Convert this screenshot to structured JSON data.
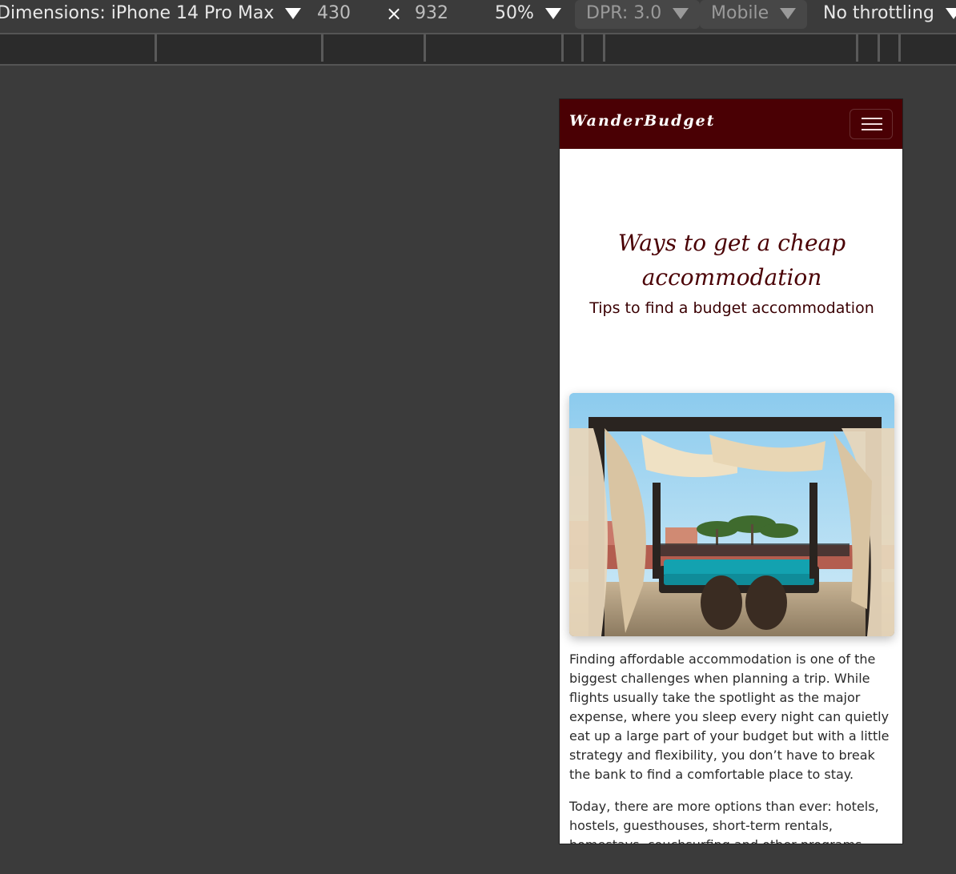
{
  "devtools": {
    "dimensions_label": "Dimensions: iPhone 14 Pro Max",
    "width": "430",
    "times": "×",
    "height": "932",
    "zoom": "50%",
    "dpr": "DPR: 3.0",
    "mode": "Mobile",
    "throttling": "No throttling"
  },
  "site": {
    "brand": "WanderBudget",
    "hero_title": "Ways to get a cheap accommodation",
    "hero_subtitle": "Tips to find a budget accommodation",
    "paragraphs": [
      "Finding affordable accommodation is one of the biggest challenges when planning a trip. While flights usually take the spotlight as the major expense, where you sleep every night can quietly eat up a large part of your budget but with a little strategy and flexibility, you don’t have to break the bank to find a comfortable place to stay.",
      "Today, there are more options than ever: hotels, hostels, guesthouses, short-term rentals, homestays, couchsurfing and other programs. Each has its own"
    ]
  },
  "colors": {
    "nav_bg": "#4a0004",
    "title": "#4a0004",
    "devtools_bg": "#3b3b3b"
  },
  "icons": {
    "menu": "hamburger-icon",
    "caret": "caret-down-icon"
  }
}
